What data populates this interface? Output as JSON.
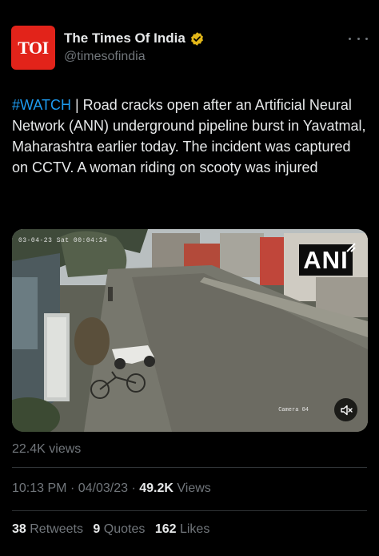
{
  "author": {
    "avatar_text": "TOI",
    "display_name": "The Times Of India",
    "handle": "@timesofindia",
    "verified_icon": "gold-verified-badge-icon"
  },
  "tweet": {
    "hashtag": "#WATCH",
    "text": " | Road cracks open after an Artificial Neural Network (ANN) underground pipeline burst in Yavatmal, Maharashtra earlier today. The incident was captured on CCTV. A woman riding on scooty was injured"
  },
  "video": {
    "cctv_timestamp": "03-04-23 Sat 00:04:24",
    "cctv_camera": "Camera 04",
    "watermark": "ANI",
    "mute_icon": "speaker-muted-icon"
  },
  "views_label": "22.4K views",
  "meta": {
    "time": "10:13 PM",
    "separator": "·",
    "date": "04/03/23",
    "views_count": "49.2K",
    "views_label": "Views"
  },
  "stats": {
    "retweets_count": "38",
    "retweets_label": "Retweets",
    "quotes_count": "9",
    "quotes_label": "Quotes",
    "likes_count": "162",
    "likes_label": "Likes"
  },
  "colors": {
    "background": "#000000",
    "text_primary": "#e7e9ea",
    "text_secondary": "#71767b",
    "link": "#1d9bf0",
    "toi_red": "#e2231a",
    "verified_gold": "#e2b719",
    "divider": "#2f3336"
  }
}
